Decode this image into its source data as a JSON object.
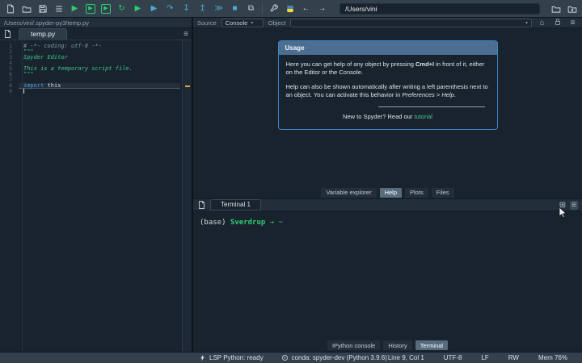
{
  "toolbar": {
    "path_value": "/Users/vini",
    "glyphs": {
      "run": "▶",
      "run_cell": "▶",
      "run_cell_advance": "▶",
      "rerun_cell": "↻",
      "run_selection": "▶",
      "debug": "▶",
      "step_over": "↷",
      "step_into": "↧",
      "step_return": "↥",
      "continue": "≫",
      "stop": "■",
      "maximize": "⧉",
      "back": "←",
      "forward": "→"
    }
  },
  "editor": {
    "breadcrumb": "/Users/vini/.spyder-py3/temp.py",
    "tab_label": "temp.py",
    "options_icon": "≡",
    "lines": [
      {
        "n": "1",
        "segs": [
          {
            "t": "# -*- coding: utf-8 -*-",
            "c": "com"
          }
        ]
      },
      {
        "n": "2",
        "segs": [
          {
            "t": "\"\"\"",
            "c": "str"
          }
        ]
      },
      {
        "n": "3",
        "segs": [
          {
            "t": "Spyder Editor",
            "c": "stri"
          }
        ]
      },
      {
        "n": "4",
        "segs": []
      },
      {
        "n": "5",
        "segs": [
          {
            "t": "This is a temporary script file.",
            "c": "stri"
          }
        ]
      },
      {
        "n": "6",
        "segs": [
          {
            "t": "\"\"\"",
            "c": "str"
          }
        ]
      },
      {
        "n": "7",
        "segs": []
      },
      {
        "n": "8",
        "segs": [
          {
            "t": "import",
            "c": "kw"
          },
          {
            "t": " this",
            "c": "pl"
          }
        ]
      },
      {
        "n": "9",
        "segs": []
      }
    ]
  },
  "help": {
    "source_label": "Source",
    "source_value": "Console",
    "object_label": "Object",
    "object_value": "",
    "dropdown_arrow": "▾",
    "home_icon": "⌂",
    "menu_icon": "≡",
    "usage": {
      "title": "Usage",
      "p1_before": "Here you can get help of any object by pressing ",
      "p1_kbd": "Cmd+I",
      "p1_after": " in front of it, either on the Editor or the Console.",
      "p2_before": "Help can also be shown automatically after writing a left parenthesis next to an object. You can activate this behavior in ",
      "p2_em": "Preferences > Help",
      "p2_after": ".",
      "footer_text": "New to Spyder? Read our ",
      "footer_link": "tutorial"
    },
    "tabs": [
      "Variable explorer",
      "Help",
      "Plots",
      "Files"
    ]
  },
  "terminal": {
    "tab_label": "Terminal 1",
    "new_icon": "⊞",
    "menu_icon": "≡",
    "prompt": {
      "env": "(base)",
      "host": "Sverdrup",
      "arrow": "→",
      "path": "~"
    }
  },
  "bottom": {
    "tabs": [
      "IPython console",
      "History",
      "Terminal"
    ]
  },
  "statusbar": {
    "lsp": "LSP Python: ready",
    "conda": "conda: spyder-dev (Python 3.9.6)",
    "cursor": "Line 9, Col 1",
    "encoding": "UTF-8",
    "eol": "LF",
    "permission": "RW",
    "memory": "Mem 76%"
  }
}
